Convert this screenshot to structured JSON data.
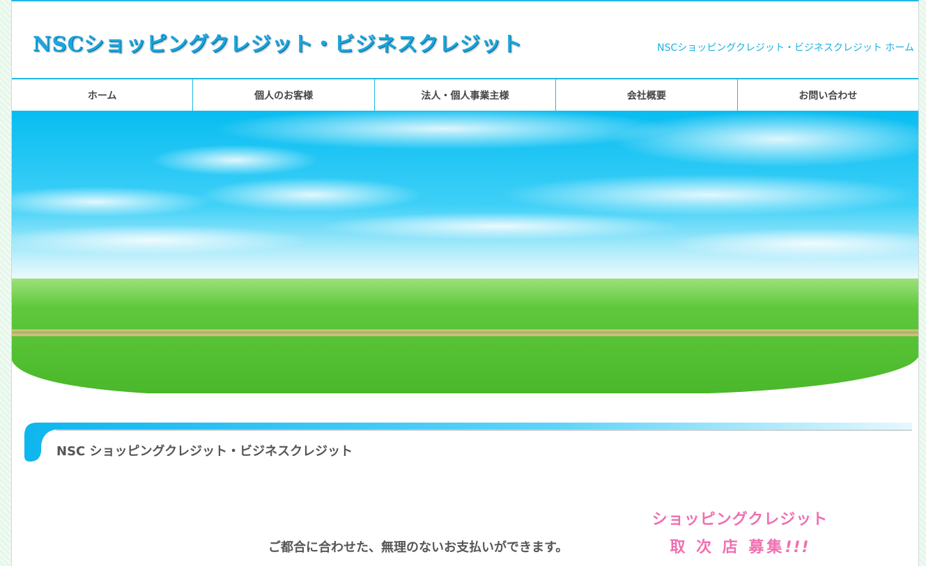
{
  "header": {
    "logo_text": "NSCショッピングクレジット・ビジネスクレジット",
    "home_link": "NSCショッピングクレジット・ビジネスクレジット ホーム"
  },
  "nav": {
    "items": [
      {
        "label": "ホーム"
      },
      {
        "label": "個人のお客様"
      },
      {
        "label": "法人・個人事業主様"
      },
      {
        "label": "会社概要"
      },
      {
        "label": "お問い合わせ"
      }
    ]
  },
  "main": {
    "section_title": "NSC ショッピングクレジット・ビジネスクレジット",
    "tagline": "ご都合に合わせた、無理のないお支払いができます。"
  },
  "recruit": {
    "line1": "ショッピングクレジット",
    "line2": "取 次 店 募集",
    "line2_excl": "!!!"
  },
  "colors": {
    "accent": "#1fb8e4",
    "nav_text": "#444444",
    "recruit_pink": "#f06fb0",
    "sky": "#0ec3f3",
    "grass": "#5cc43c"
  }
}
